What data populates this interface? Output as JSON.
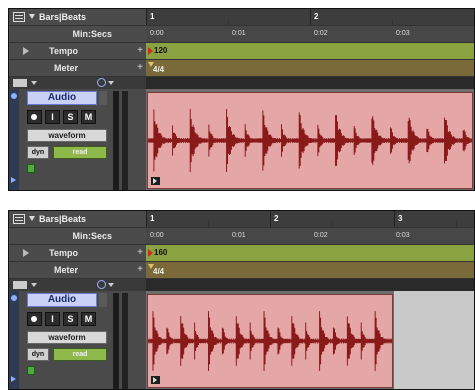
{
  "rulers": {
    "bars_beats_label": "Bars|Beats",
    "min_secs_label": "Min:Secs",
    "tempo_label": "Tempo",
    "meter_label": "Meter",
    "add_symbol": "+"
  },
  "panel_a": {
    "bars": [
      "1",
      "2"
    ],
    "times": [
      "0:00",
      "0:01",
      "0:02",
      "0:03"
    ],
    "tempo_value": "120",
    "meter_value": "4/4",
    "track": {
      "name": "Audio",
      "buttons": [
        "",
        "I",
        "S",
        "M"
      ],
      "view": "waveform",
      "dyn": "dyn",
      "automation": "read"
    }
  },
  "panel_b": {
    "bars": [
      "1",
      "2",
      "3"
    ],
    "times": [
      "0:00",
      "0:01",
      "0:02",
      "0:03"
    ],
    "tempo_value": "160",
    "meter_value": "4/4",
    "track": {
      "name": "Audio",
      "buttons": [
        "",
        "I",
        "S",
        "M"
      ],
      "view": "waveform",
      "dyn": "dyn",
      "automation": "read"
    }
  },
  "colors": {
    "tempo_lane": "#8aa23f",
    "meter_lane": "#7a6a3a",
    "clip_fill": "#e5a6a6",
    "waveform": "#8a1a1a",
    "track_name_bg": "#c9d2f5"
  }
}
